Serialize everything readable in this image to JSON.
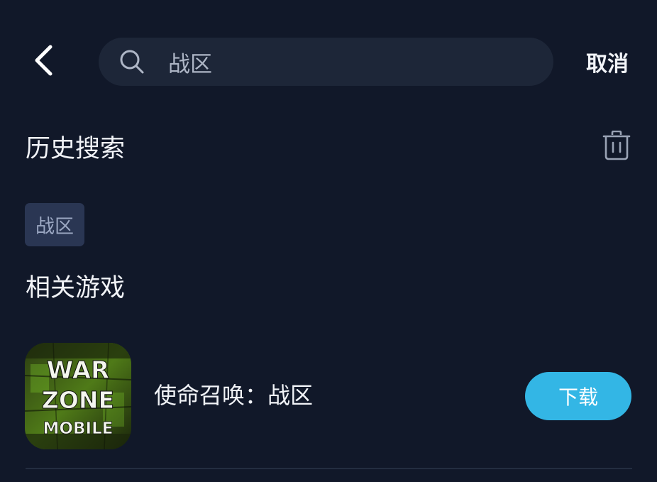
{
  "header": {
    "back_icon": "chevron-left-icon",
    "search": {
      "icon": "search-icon",
      "value": "战区",
      "placeholder": ""
    },
    "cancel_label": "取消"
  },
  "history": {
    "title": "历史搜索",
    "clear_icon": "trash-icon",
    "items": [
      {
        "label": "战区"
      }
    ]
  },
  "related": {
    "title": "相关游戏",
    "games": [
      {
        "icon_text": [
          "WAR",
          "ZONE",
          "MOBILE"
        ],
        "name": "使命召唤：战区",
        "action_label": "下载"
      }
    ]
  },
  "colors": {
    "background": "#111829",
    "search_bg": "#1d2638",
    "chip_bg": "#2a3653",
    "chip_text": "#9ba7c2",
    "accent": "#33b6e5",
    "icon_green": "#7ecb2a"
  }
}
